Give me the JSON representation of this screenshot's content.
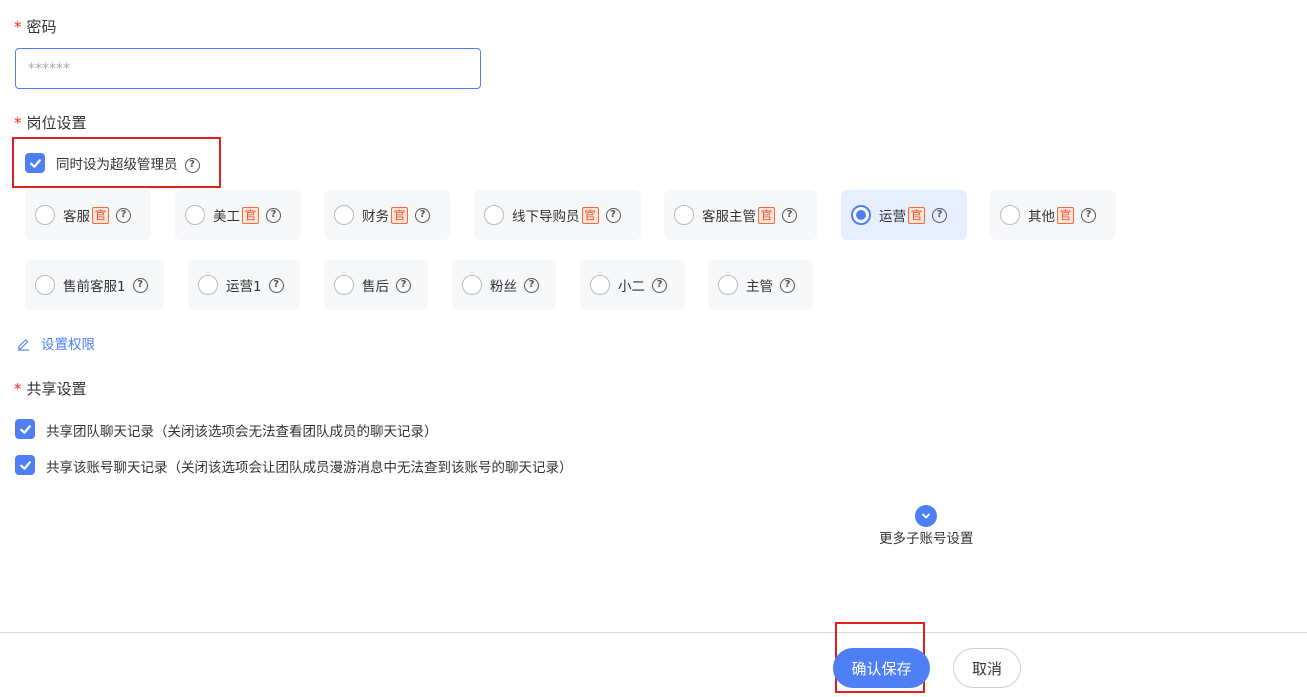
{
  "password": {
    "label": "密码",
    "required_mark": "*",
    "placeholder": "******"
  },
  "position": {
    "label": "岗位设置",
    "required_mark": "*",
    "super_admin_label": "同时设为超级管理员",
    "official_tag": "官",
    "roles": [
      {
        "label": "客服",
        "official": true,
        "selected": false
      },
      {
        "label": "美工",
        "official": true,
        "selected": false
      },
      {
        "label": "财务",
        "official": true,
        "selected": false
      },
      {
        "label": "线下导购员",
        "official": true,
        "selected": false
      },
      {
        "label": "客服主管",
        "official": true,
        "selected": false
      },
      {
        "label": "运营",
        "official": true,
        "selected": true
      },
      {
        "label": "其他",
        "official": true,
        "selected": false
      },
      {
        "label": "售前客服1",
        "official": false,
        "selected": false
      },
      {
        "label": "运营1",
        "official": false,
        "selected": false
      },
      {
        "label": "售后",
        "official": false,
        "selected": false
      },
      {
        "label": "粉丝",
        "official": false,
        "selected": false
      },
      {
        "label": "小二",
        "official": false,
        "selected": false
      },
      {
        "label": "主管",
        "official": false,
        "selected": false
      }
    ]
  },
  "permissions_link": "设置权限",
  "share": {
    "label": "共享设置",
    "required_mark": "*",
    "options": [
      {
        "label": "共享团队聊天记录（关闭该选项会无法查看团队成员的聊天记录）",
        "checked": true
      },
      {
        "label": "共享该账号聊天记录（关闭该选项会让团队成员漫游消息中无法查到该账号的聊天记录）",
        "checked": true
      }
    ]
  },
  "more_settings": "更多子账号设置",
  "footer": {
    "confirm": "确认保存",
    "cancel": "取消"
  },
  "colors": {
    "accent": "#4e7ff5",
    "required": "#f5222d",
    "highlight_box": "#e02020"
  }
}
